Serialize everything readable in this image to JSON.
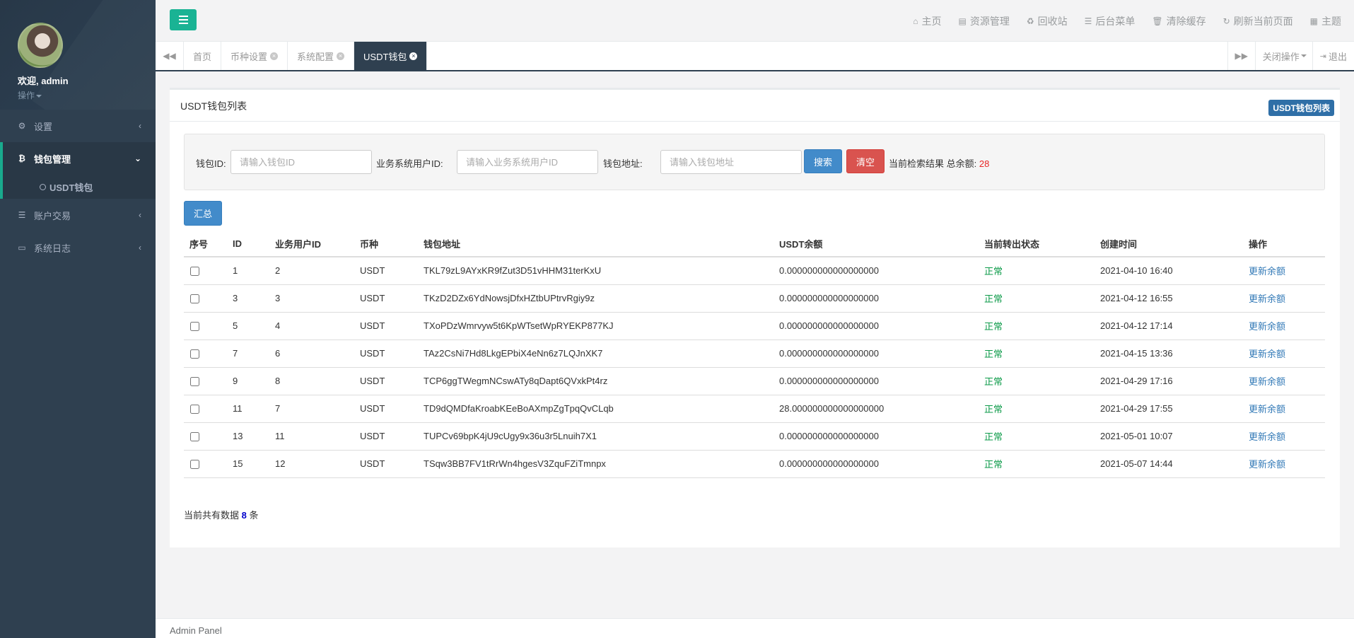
{
  "profile": {
    "welcome": "欢迎, admin",
    "ops": "操作"
  },
  "sidebar": {
    "items": [
      {
        "label": "设置",
        "icon": "gears-icon"
      },
      {
        "label": "钱包管理",
        "icon": "bitcoin-icon",
        "sub": "USDT钱包"
      },
      {
        "label": "账户交易",
        "icon": "list-icon"
      },
      {
        "label": "系统日志",
        "icon": "desktop-icon"
      }
    ]
  },
  "topbar": {
    "links": [
      "主页",
      "资源管理",
      "回收站",
      "后台菜单",
      "清除缓存",
      "刷新当前页面",
      "主题"
    ]
  },
  "tabs": [
    "首页",
    "币种设置",
    "系统配置",
    "USDT钱包"
  ],
  "tabbar": {
    "close_ops": "关闭操作",
    "logout": "退出"
  },
  "panel": {
    "title": "USDT钱包列表",
    "badge": "USDT钱包列表"
  },
  "search": {
    "wallet_id_label": "钱包ID:",
    "wallet_id_placeholder": "请输入钱包ID",
    "user_id_label": "业务系统用户ID:",
    "user_id_placeholder": "请输入业务系统用户ID",
    "address_label": "钱包地址:",
    "address_placeholder": "请输入钱包地址",
    "search_button": "搜索",
    "clear_button": "清空",
    "result_prefix": "当前检索结果 总余额:",
    "total_balance": "28"
  },
  "summary_button": "汇总",
  "table": {
    "headers": [
      "序号",
      "ID",
      "业务用户ID",
      "币种",
      "钱包地址",
      "USDT余额",
      "当前转出状态",
      "创建时间",
      "操作"
    ],
    "rows": [
      {
        "id": "1",
        "user_id": "2",
        "coin": "USDT",
        "address": "TKL79zL9AYxKR9fZut3D51vHHM31terKxU",
        "balance": "0.000000000000000000",
        "status": "正常",
        "created": "2021-04-10 16:40",
        "op": "更新余额"
      },
      {
        "id": "3",
        "user_id": "3",
        "coin": "USDT",
        "address": "TKzD2DZx6YdNowsjDfxHZtbUPtrvRgiy9z",
        "balance": "0.000000000000000000",
        "status": "正常",
        "created": "2021-04-12 16:55",
        "op": "更新余额"
      },
      {
        "id": "5",
        "user_id": "4",
        "coin": "USDT",
        "address": "TXoPDzWmrvyw5t6KpWTsetWpRYEKP877KJ",
        "balance": "0.000000000000000000",
        "status": "正常",
        "created": "2021-04-12 17:14",
        "op": "更新余额"
      },
      {
        "id": "7",
        "user_id": "6",
        "coin": "USDT",
        "address": "TAz2CsNi7Hd8LkgEPbiX4eNn6z7LQJnXK7",
        "balance": "0.000000000000000000",
        "status": "正常",
        "created": "2021-04-15 13:36",
        "op": "更新余额"
      },
      {
        "id": "9",
        "user_id": "8",
        "coin": "USDT",
        "address": "TCP6ggTWegmNCswATy8qDapt6QVxkPt4rz",
        "balance": "0.000000000000000000",
        "status": "正常",
        "created": "2021-04-29 17:16",
        "op": "更新余额"
      },
      {
        "id": "11",
        "user_id": "7",
        "coin": "USDT",
        "address": "TD9dQMDfaKroabKEeBoAXmpZgTpqQvCLqb",
        "balance": "28.000000000000000000",
        "status": "正常",
        "created": "2021-04-29 17:55",
        "op": "更新余额"
      },
      {
        "id": "13",
        "user_id": "11",
        "coin": "USDT",
        "address": "TUPCv69bpK4jU9cUgy9x36u3r5Lnuih7X1",
        "balance": "0.000000000000000000",
        "status": "正常",
        "created": "2021-05-01 10:07",
        "op": "更新余额"
      },
      {
        "id": "15",
        "user_id": "12",
        "coin": "USDT",
        "address": "TSqw3BB7FV1tRrWn4hgesV3ZquFZiTmnpx",
        "balance": "0.000000000000000000",
        "status": "正常",
        "created": "2021-05-07 14:44",
        "op": "更新余额"
      }
    ]
  },
  "footer": {
    "prefix": "当前共有数据",
    "count": "8",
    "suffix": "条"
  },
  "admin_footer": "Admin Panel",
  "colors": {
    "sidebar": "#2f4050",
    "accent": "#1ab394",
    "primary": "#428bca",
    "danger": "#d9534f",
    "status_ok": "#0b9a48"
  }
}
